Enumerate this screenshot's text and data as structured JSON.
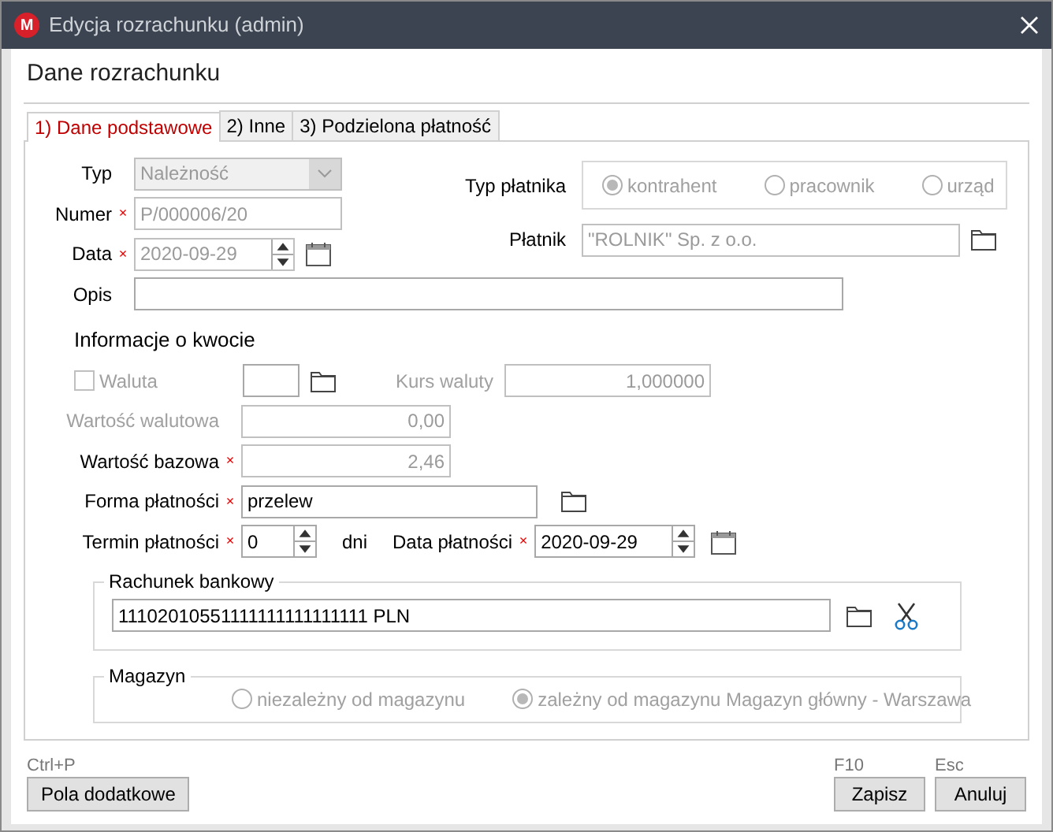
{
  "window": {
    "title": "Edycja rozrachunku (admin)",
    "logo": "M"
  },
  "header": "Dane rozrachunku",
  "required_mark": "×",
  "tabs": [
    {
      "label": "1) Dane podstawowe",
      "selected": true
    },
    {
      "label": "2) Inne",
      "selected": false
    },
    {
      "label": "3) Podzielona płatność",
      "selected": false
    }
  ],
  "type": {
    "label": "Typ",
    "value": "Należność",
    "disabled": true,
    "required": false
  },
  "number": {
    "label": "Numer",
    "value": "P/000006/20",
    "disabled": true,
    "required": true
  },
  "date": {
    "label": "Data",
    "value": "2020-09-29",
    "disabled": true,
    "required": true
  },
  "payer_type": {
    "label": "Typ płatnika",
    "disabled": true,
    "options": [
      {
        "label": "kontrahent",
        "selected": true
      },
      {
        "label": "pracownik",
        "selected": false
      },
      {
        "label": "urząd",
        "selected": false
      }
    ]
  },
  "payer": {
    "label": "Płatnik",
    "value": "\"ROLNIK\" Sp. z o.o.",
    "disabled": true
  },
  "description": {
    "label": "Opis"
  },
  "amount_title": "Informacje o kwocie",
  "currency": {
    "label": "Waluta",
    "checked": false,
    "disabled": true
  },
  "exchange_rate": {
    "label": "Kurs waluty",
    "value": "1,000000",
    "disabled": true
  },
  "currency_value": {
    "label": "Wartość walutowa",
    "value": "0,00",
    "disabled": true,
    "required": false
  },
  "base_value": {
    "label": "Wartość bazowa",
    "value": "2,46",
    "disabled": true,
    "required": true
  },
  "payment_form": {
    "label": "Forma płatności",
    "value": "przelew",
    "disabled": false,
    "required": true
  },
  "payment_term": {
    "label": "Termin płatności",
    "value": "0",
    "unit": "dni",
    "disabled": false,
    "required": true
  },
  "payment_date": {
    "label": "Data płatności",
    "value": "2020-09-29",
    "disabled": false,
    "required": true
  },
  "bank_account": {
    "title": "Rachunek bankowy",
    "value": "11102010551111111111111111 PLN"
  },
  "warehouse": {
    "title": "Magazyn",
    "disabled": true,
    "options": [
      {
        "label": "niezależny od magazynu",
        "selected": false
      },
      {
        "label": "zależny od magazynu Magazyn główny - Warszawa",
        "selected": true
      }
    ]
  },
  "footer": {
    "left": [
      {
        "shortcut": "Ctrl+P",
        "label": "Pola dodatkowe"
      }
    ],
    "right": [
      {
        "shortcut": "F10",
        "label": "Zapisz"
      },
      {
        "shortcut": "Esc",
        "label": "Anuluj"
      }
    ]
  }
}
